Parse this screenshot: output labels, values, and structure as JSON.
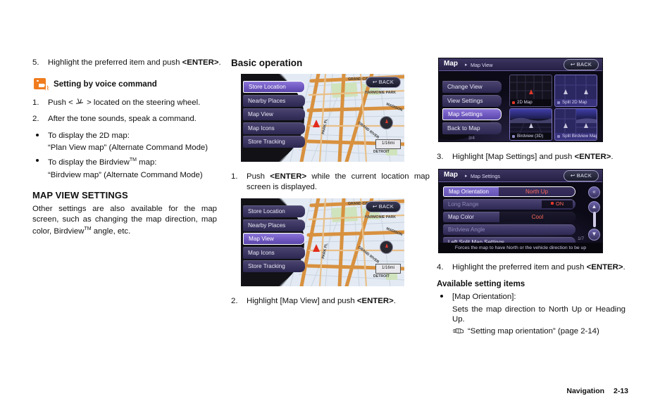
{
  "left_column": {
    "step5": {
      "num": "5.",
      "text_before": "Highlight the preferred item and push ",
      "bold": "<ENTER>",
      "text_after": "."
    },
    "voice": {
      "icon": "voice-command-icon",
      "title": "Setting by voice command",
      "step1_num": "1.",
      "step1_before": "Push < ",
      "step1_icon": "steering-voice-button-icon",
      "step1_after": " > located on the steering wheel.",
      "step2_num": "2.",
      "step2_text": "After the tone sounds, speak a command.",
      "bullet1_line1": "To display the 2D map:",
      "bullet1_line2": "“Plan View map” (Alternate Command Mode)",
      "bullet2_line1_pre": "To display the Birdview",
      "bullet2_line1_sup": "TM",
      "bullet2_line1_post": " map:",
      "bullet2_line2": "“Birdview map” (Alternate Command Mode)"
    },
    "section_title": "MAP VIEW SETTINGS",
    "section_body_pre": "Other settings are also available for the map screen, such as changing the map direction, map color, Birdview",
    "section_body_sup": "TM",
    "section_body_post": " angle, etc."
  },
  "mid_column": {
    "heading": "Basic operation",
    "shot1": {
      "name": "current-location-map-menu",
      "back_label": "BACK",
      "scale_label": "1/16mi",
      "menu_items": [
        {
          "label": "Store Location",
          "selected": true
        },
        {
          "label": "Nearby Places",
          "selected": false
        },
        {
          "label": "Map View",
          "selected": false
        },
        {
          "label": "Map Icons",
          "selected": false
        },
        {
          "label": "Store Tracking",
          "selected": false
        }
      ],
      "map_labels": [
        "GRAND CIRCUS",
        "HARMONIE PARK",
        "MADISON",
        "PARK PL",
        "GRAND RIVER",
        "DETROIT"
      ]
    },
    "step1_num": "1.",
    "step1_before": "Push ",
    "step1_bold": "<ENTER>",
    "step1_after": " while the current location map screen is displayed.",
    "shot2": {
      "name": "map-view-highlighted-menu",
      "back_label": "BACK",
      "scale_label": "1/16mi",
      "menu_items": [
        {
          "label": "Store Location",
          "selected": false
        },
        {
          "label": "Nearby Places",
          "selected": false
        },
        {
          "label": "Map View",
          "selected": true
        },
        {
          "label": "Map Icons",
          "selected": false
        },
        {
          "label": "Store Tracking",
          "selected": false
        }
      ]
    },
    "step2_num": "2.",
    "step2_before": "Highlight [Map View] and push ",
    "step2_bold": "<ENTER>",
    "step2_after": "."
  },
  "right_column": {
    "shot3": {
      "name": "map-view-screen",
      "title": "Map",
      "breadcrumb": "Map View",
      "back_label": "BACK",
      "menu_items": [
        {
          "label": "Change View",
          "selected": false
        },
        {
          "label": "View Settings",
          "selected": false
        },
        {
          "label": "Map Settings",
          "selected": true
        },
        {
          "label": "Back to Map",
          "selected": false
        }
      ],
      "thumbnails": [
        {
          "label": "2D Map",
          "selected": true
        },
        {
          "label": "Split 2D Map",
          "selected": false
        },
        {
          "label": "Birdview (3D)",
          "selected": false
        },
        {
          "label": "Split Birdview Map",
          "selected": false
        }
      ],
      "page_indicator": "3/4"
    },
    "step3_num": "3.",
    "step3_before": "Highlight [Map Settings] and push ",
    "step3_bold": "<ENTER>",
    "step3_after": ".",
    "shot4": {
      "name": "map-settings-screen",
      "title": "Map",
      "breadcrumb": "Map Settings",
      "back_label": "BACK",
      "rows": [
        {
          "label": "Map Orientation",
          "value": "North Up",
          "selected": true,
          "dim": false,
          "toggle": null
        },
        {
          "label": "Long Range",
          "value": null,
          "selected": false,
          "dim": true,
          "toggle": "ON"
        },
        {
          "label": "Map Color",
          "value": "Cool",
          "selected": false,
          "dim": false,
          "toggle": null
        },
        {
          "label": "Birdview Angle",
          "value": null,
          "selected": false,
          "dim": true,
          "toggle": null
        },
        {
          "label": "Left Split Map Settings",
          "value": null,
          "selected": false,
          "dim": false,
          "toggle": null
        }
      ],
      "page_indicator": "1/7",
      "hint": "Forces the map to have North or the vehicle direction to be up",
      "side_buttons": [
        "«",
        "▲",
        "▼",
        "»"
      ]
    },
    "step4_num": "4.",
    "step4_before": "Highlight the preferred item and push ",
    "step4_bold": "<ENTER>",
    "step4_after": ".",
    "avail_heading": "Available setting items",
    "avail_bullet": "[Map Orientation]:",
    "avail_desc": "Sets the map direction to North Up or Heading Up.",
    "avail_ref": "“Setting map orientation” (page 2-14)"
  },
  "footer": {
    "section": "Navigation",
    "page": "2-13"
  },
  "colors": {
    "accent_orange": "#f07c1e",
    "menu_purple": "#3b3563",
    "selected_purple": "#6f58c0",
    "value_red": "#ff6a5a",
    "map_road": "#d8913f",
    "map_water": "#dfe8f2"
  }
}
